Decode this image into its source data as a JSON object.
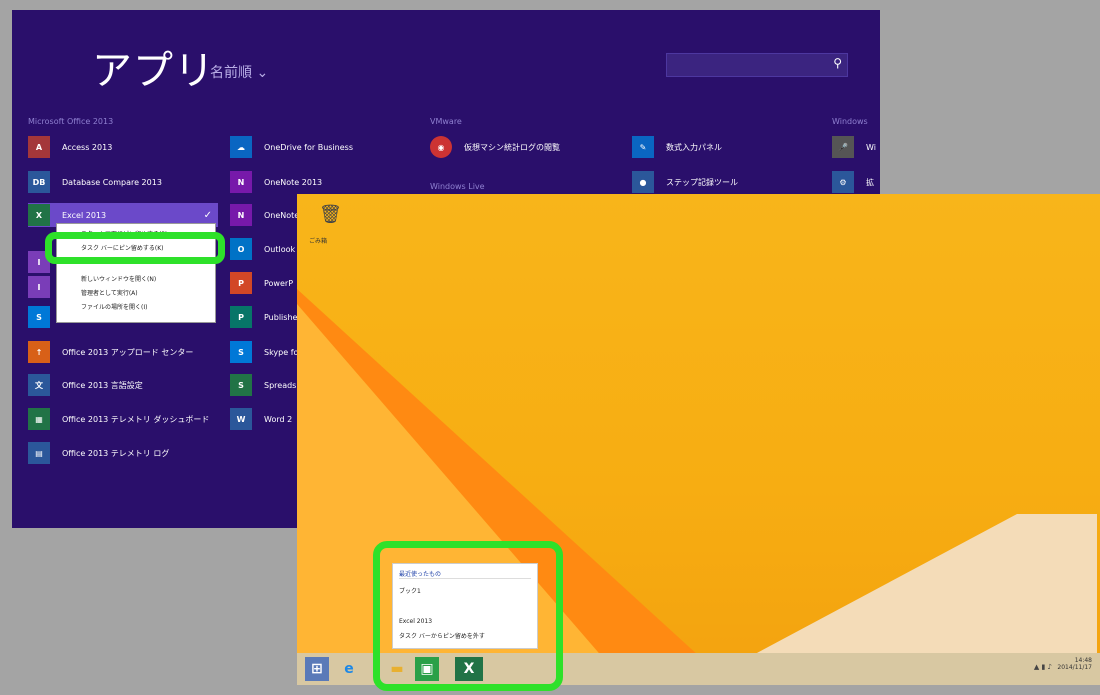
{
  "apps": {
    "title": "アプリ",
    "sort": "名前順 ⌄",
    "search_icon": "search-icon",
    "groups": [
      "Microsoft Office 2013",
      "VMware",
      "Windows Live",
      "Windows"
    ],
    "col1": [
      {
        "label": "Access 2013",
        "tile": "A",
        "color": "#a4373a"
      },
      {
        "label": "Database Compare 2013",
        "tile": "DB",
        "color": "#2b579a"
      },
      {
        "label": "Excel 2013",
        "tile": "X",
        "color": "#217346"
      },
      {
        "label": "",
        "tile": "I",
        "color": "#7a3db8"
      },
      {
        "label": "",
        "tile": "I",
        "color": "#7a3db8"
      },
      {
        "label": "",
        "tile": "S",
        "color": "#0078d7"
      },
      {
        "label": "Office 2013 アップロード センター",
        "tile": "↑",
        "color": "#d86018"
      },
      {
        "label": "Office 2013 言語設定",
        "tile": "文",
        "color": "#2b579a"
      },
      {
        "label": "Office 2013 テレメトリ ダッシュボード",
        "tile": "▦",
        "color": "#217346"
      },
      {
        "label": "Office 2013 テレメトリ ログ",
        "tile": "▤",
        "color": "#2b579a"
      }
    ],
    "col2": [
      {
        "label": "OneDrive for Business",
        "tile": "☁",
        "color": "#0a66c2"
      },
      {
        "label": "OneNote 2013",
        "tile": "N",
        "color": "#7719aa"
      },
      {
        "label": "OneNote",
        "tile": "N",
        "color": "#7719aa"
      },
      {
        "label": "Outlook",
        "tile": "O",
        "color": "#0072c6"
      },
      {
        "label": "PowerP",
        "tile": "P",
        "color": "#d24726"
      },
      {
        "label": "Publishe",
        "tile": "P",
        "color": "#077568"
      },
      {
        "label": "Skype fo",
        "tile": "S",
        "color": "#0078d7"
      },
      {
        "label": "Spreads",
        "tile": "S",
        "color": "#217346"
      },
      {
        "label": "Word 2",
        "tile": "W",
        "color": "#2b579a"
      }
    ],
    "col3": [
      {
        "label": "仮想マシン統計ログの閲覧",
        "tile": "◉",
        "color": "#cc3333"
      }
    ],
    "col4": [
      {
        "label": "数式入力パネル",
        "tile": "✎",
        "color": "#0a66c2"
      },
      {
        "label": "ステップ記録ツール",
        "tile": "●",
        "color": "#2b579a"
      }
    ],
    "col5": [
      {
        "label": "Wi",
        "tile": "🎤",
        "color": "#555555"
      },
      {
        "label": "拡",
        "tile": "⚙",
        "color": "#2b579a"
      }
    ],
    "context_menu": {
      "item1": "スタート画面にピン留めする(P)",
      "item2": "タスク バーにピン留めする(K)",
      "item3": "新しいウィンドウを開く(N)",
      "item4": "管理者として実行(A)",
      "item5": "ファイルの場所を開く(I)"
    }
  },
  "desktop": {
    "recycle_bin": "ごみ箱",
    "jump_list": {
      "header": "最近使ったもの",
      "item1": "ブック1",
      "item2": "Excel 2013",
      "item3": "タスク バーからピン留めを外す"
    },
    "clock": {
      "time": "14:48",
      "date": "2014/11/17"
    }
  }
}
